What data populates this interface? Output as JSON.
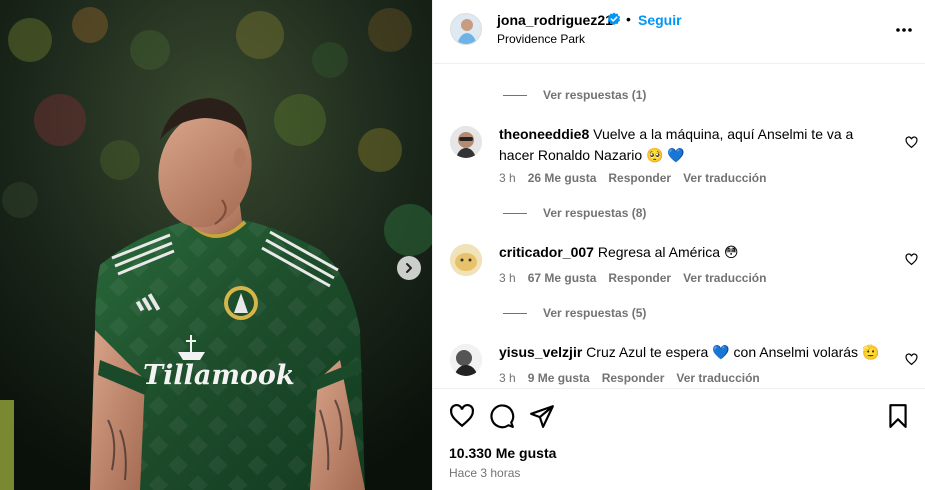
{
  "post": {
    "username": "jona_rodriguez21",
    "separator": "•",
    "follow_label": "Seguir",
    "location": "Providence Park",
    "likes": "10.330 Me gusta",
    "time_ago": "Hace 3 horas"
  },
  "media": {
    "jersey_sponsor": "Tillamook"
  },
  "comments": {
    "thread_replies_1": "Ver respuestas (1)",
    "items": [
      {
        "username": "theoneeddie8",
        "text": "Vuelve a la máquina, aquí Anselmi te va a hacer Ronaldo Nazario 🥺 💙",
        "time": "3 h",
        "likes": "26 Me gusta",
        "reply": "Responder",
        "translate": "Ver traducción",
        "replies": "Ver respuestas (8)"
      },
      {
        "username": "criticador_007",
        "text": "Regresa al América 😳",
        "time": "3 h",
        "likes": "67 Me gusta",
        "reply": "Responder",
        "translate": "Ver traducción",
        "replies": "Ver respuestas (5)"
      },
      {
        "username": "yisus_velzjir",
        "text": "Cruz Azul te espera 💙  con Anselmi volarás 🫡",
        "time": "3 h",
        "likes": "9 Me gusta",
        "reply": "Responder",
        "translate": "Ver traducción"
      }
    ]
  },
  "colors": {
    "accent": "#0095f6",
    "verified": "#0095f6",
    "meta_text": "#737373",
    "jersey_green": "#1f4b2c"
  },
  "icons": [
    "chevron-right-icon",
    "verified-badge-icon",
    "more-icon",
    "heart-icon",
    "comment-icon",
    "share-icon",
    "bookmark-icon"
  ]
}
